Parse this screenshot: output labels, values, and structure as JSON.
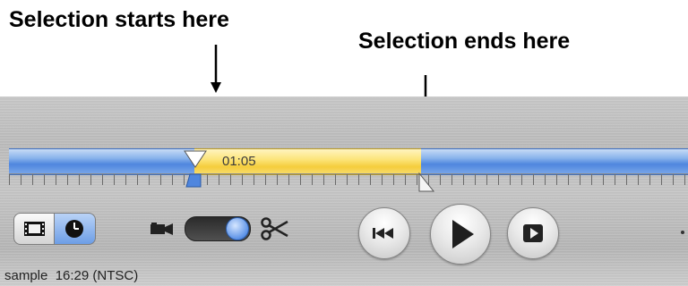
{
  "annotations": {
    "start_label": "Selection starts here",
    "end_label": "Selection ends here"
  },
  "timeline": {
    "selection_duration": "01:05",
    "selection_start_fraction": 0.27,
    "selection_end_fraction": 0.61
  },
  "controls": {
    "view_modes": [
      "film-strip-icon",
      "clock-icon"
    ],
    "active_view_mode": "clock-icon",
    "toggle_left_icon": "camera-icon",
    "toggle_right_icon": "scissors-icon",
    "playback": [
      "rewind-icon",
      "play-icon",
      "fullscreen-play-icon"
    ]
  },
  "status": {
    "text": "sample  16:29 (NTSC)"
  },
  "colors": {
    "timeline_blue": "#5b8fe0",
    "selection_yellow": "#f7d85a",
    "panel_gray": "#c2c2c2"
  }
}
